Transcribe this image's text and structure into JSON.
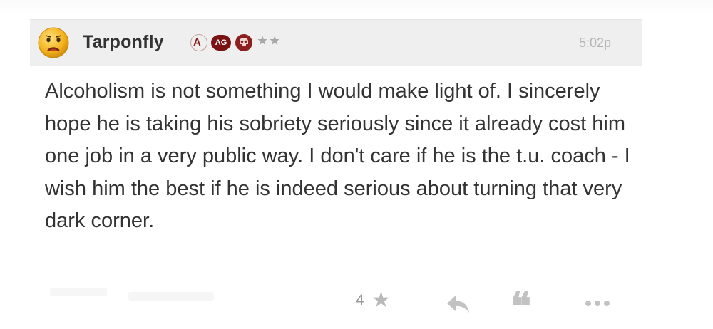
{
  "comment": {
    "username": "Tarponfly",
    "badges": {
      "a_label": "A",
      "ag_label": "AG",
      "skull_icon": "skull-badge-icon",
      "stars": "★★"
    },
    "timestamp": "5:02p",
    "text": "Alcoholism is not something I would make light of. I sincerely hope he is taking his sobriety seriously since it already cost him one job in a very public way. I don't care if he is the t.u. coach - I wish him the best if he is indeed serious about turning that very dark corner.",
    "avatar_icon": "sad-face-avatar",
    "actions": {
      "like_count": "4",
      "like_icon": "★",
      "reply_icon": "reply-arrow-icon",
      "quote_icon": "❝",
      "more_icon": "ellipsis-icon"
    }
  },
  "colors": {
    "header_bg": "#efefef",
    "username": "#333333",
    "badge_maroon": "#7a1414",
    "muted": "#b2b2b2"
  }
}
